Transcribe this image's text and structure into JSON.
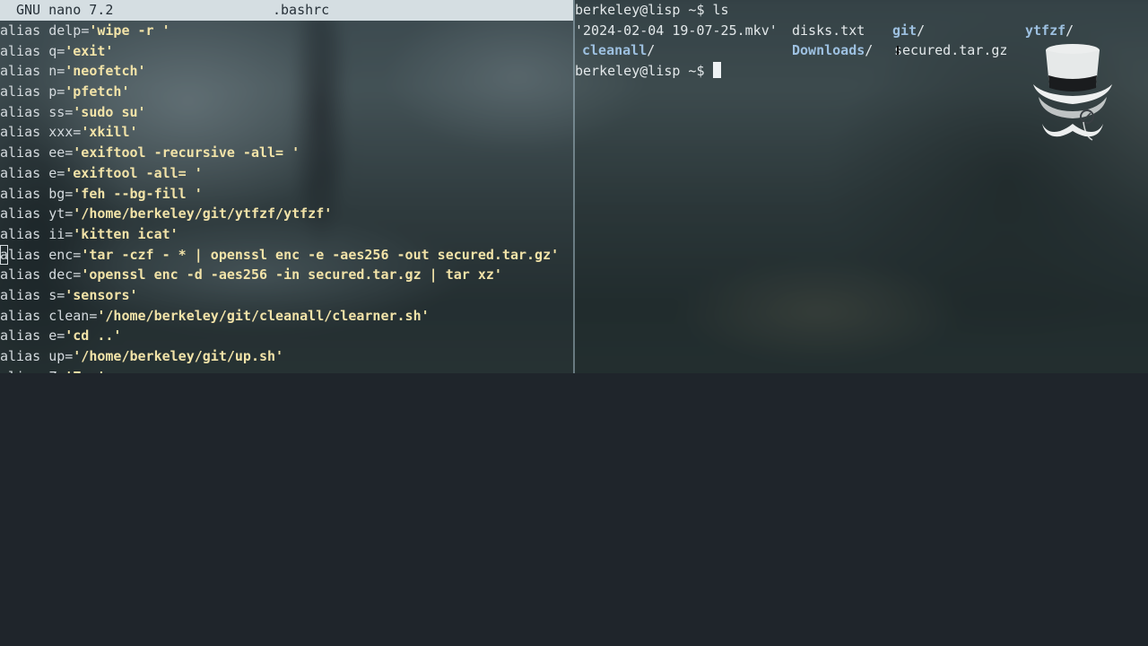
{
  "nano": {
    "version": "GNU nano 7.2",
    "filename": ".bashrc",
    "lines": [
      {
        "name": "delp",
        "value": "'wipe -r '"
      },
      {
        "name": "q",
        "value": "'exit'"
      },
      {
        "name": "n",
        "value": "'neofetch'"
      },
      {
        "name": "p",
        "value": "'pfetch'"
      },
      {
        "name": "ss",
        "value": "'sudo su'"
      },
      {
        "name": "xxx",
        "value": "'xkill'"
      },
      {
        "name": "ee",
        "value": "'exiftool -recursive -all= '"
      },
      {
        "name": "e",
        "value": "'exiftool -all= '"
      },
      {
        "name": "bg",
        "value": "'feh --bg-fill '"
      },
      {
        "name": "yt",
        "value": "'/home/berkeley/git/ytfzf/ytfzf'"
      },
      {
        "name": "ii",
        "value": "'kitten icat'"
      },
      {
        "name": "enc",
        "value": "'tar -czf - * | openssl enc -e -aes256 -out secured.tar.gz'"
      },
      {
        "name": "dec",
        "value": "'openssl enc -d -aes256 -in secured.tar.gz | tar xz'"
      },
      {
        "name": "s",
        "value": "'sensors'"
      },
      {
        "name": "clean",
        "value": "'/home/berkeley/git/cleanall/clearner.sh'"
      },
      {
        "name": "e",
        "value": "'cd ..'"
      },
      {
        "name": "up",
        "value": "'/home/berkeley/git/up.sh'"
      },
      {
        "name": "Z",
        "value": "'Z..'"
      }
    ],
    "keyword": "alias",
    "cursor_char": "a",
    "cursor_rest": "lias"
  },
  "terminal": {
    "prompt": "berkeley@lisp ~$",
    "command": "ls",
    "ls_row1": {
      "video": "'2024-02-04 19-07-25.mkv'",
      "disks": "disks.txt",
      "git": "git",
      "ytfzf": "ytfzf"
    },
    "ls_row2": {
      "cleanall": "cleanall",
      "downloads": "Downloads",
      "secured": "secured.tar.gz"
    },
    "dir_suffix": "/"
  },
  "colors": {
    "string": "#f2e3a8",
    "directory": "#9dc0e0",
    "titlebar": "#d5dee2"
  },
  "icons": {
    "logo": "top-hat-monocle-mustache-icon"
  }
}
